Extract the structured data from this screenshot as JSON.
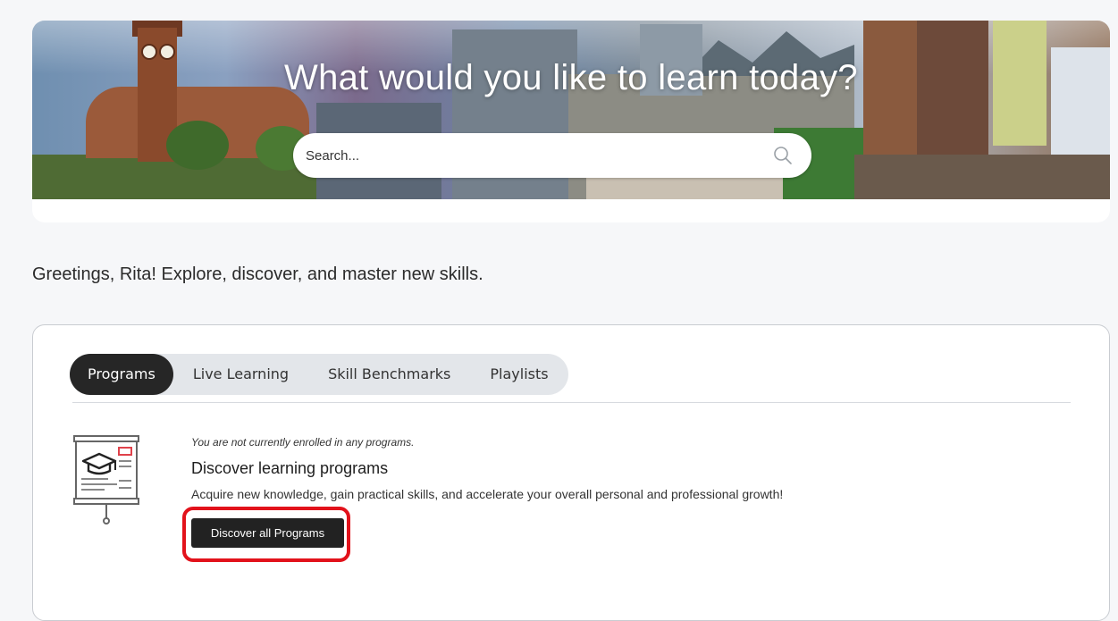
{
  "hero": {
    "title": "What would you like to learn today?",
    "search_placeholder": "Search..."
  },
  "greeting": "Greetings, Rita! Explore, discover, and master new skills.",
  "tabs": [
    {
      "label": "Programs",
      "active": true
    },
    {
      "label": "Live Learning",
      "active": false
    },
    {
      "label": "Skill Benchmarks",
      "active": false
    },
    {
      "label": "Playlists",
      "active": false
    }
  ],
  "programs": {
    "empty_note": "You are not currently enrolled in any programs.",
    "title": "Discover learning programs",
    "description": "Acquire new knowledge, gain practical skills, and accelerate your overall personal and professional growth!",
    "button_label": "Discover all Programs",
    "icon": "presentation-board-graduation-cap-icon"
  },
  "colors": {
    "highlight": "#e2121b",
    "active_tab": "#262626",
    "tab_bar": "#e3e6ea",
    "button": "#222222"
  }
}
